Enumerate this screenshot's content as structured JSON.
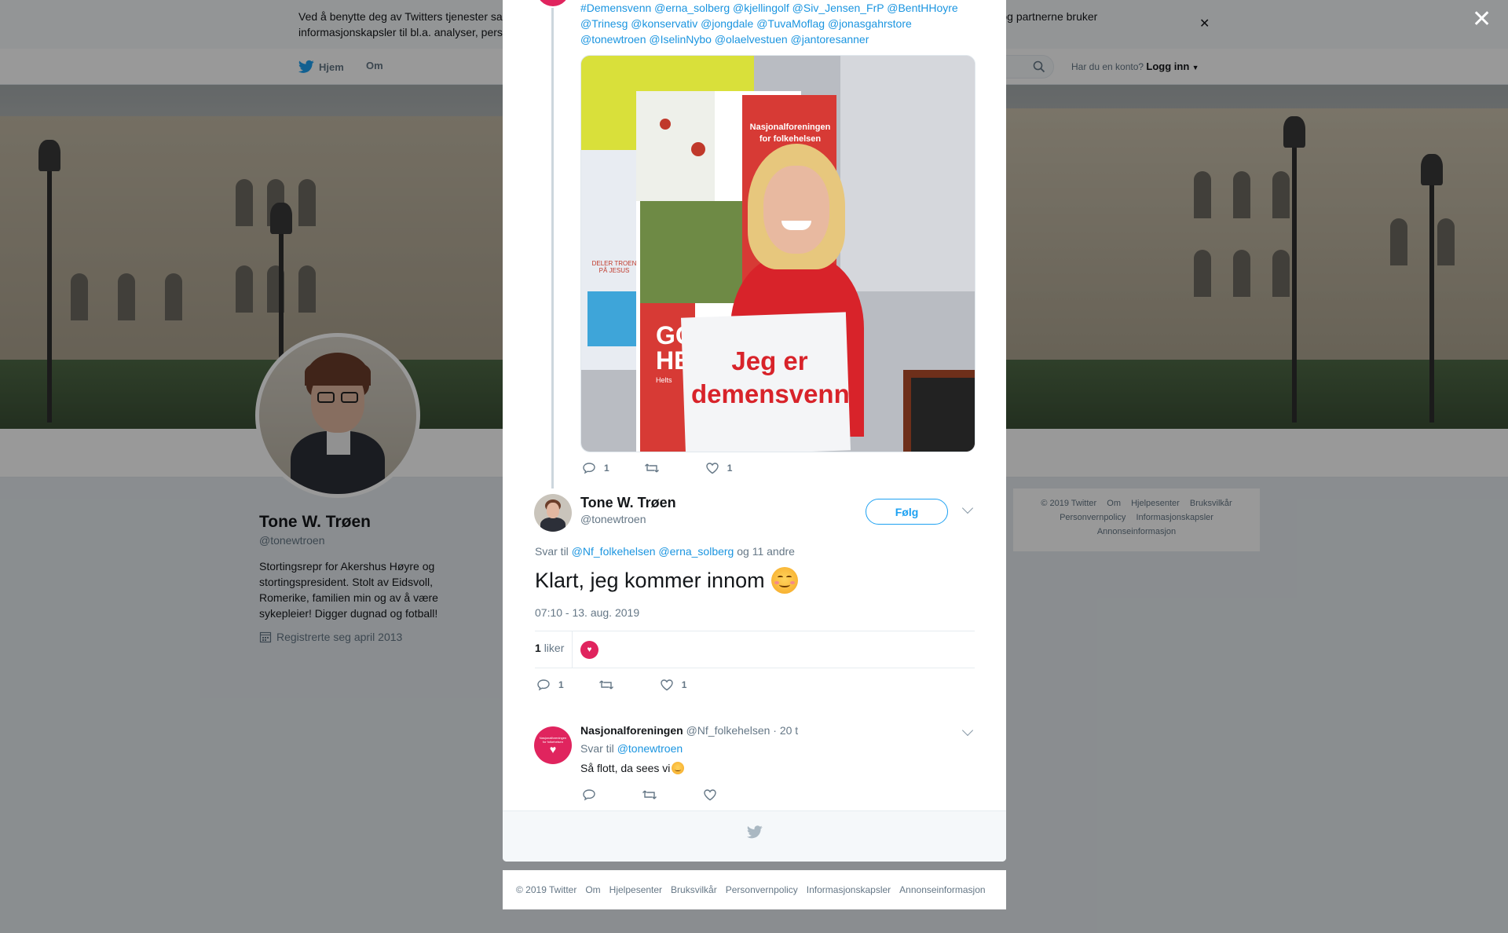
{
  "cookie_bar": {
    "text": "Ved å benytte deg av Twitters tjenester samtykker du i at vi kan bruke informasjonskapsler, inkludert informasjonskapsler fra tredjeparter. Twitter og partnerne bruker informasjonskapsler til bl.a. analyser, personalisering og annonser."
  },
  "topnav": {
    "home_label": "Hjem",
    "about_label": "Om",
    "account_prompt": "Har du en konto?",
    "login_label": "Logg inn"
  },
  "profile": {
    "name": "Tone W. Trøen",
    "handle": "@tonewtroen",
    "bio": "Stortingsrepr for Akershus Høyre og stortingspresident. Stolt av Eidsvoll, Romerike, familien min og av å være sykepleier! Digger dugnad og fotball!",
    "joined": "Registrerte seg april 2013"
  },
  "side_footer": {
    "links": [
      "© 2019 Twitter",
      "Om",
      "Hjelpesenter",
      "Bruksvilkår",
      "Personvernpolicy",
      "Informasjonskapsler",
      "Annonseinformasjon"
    ]
  },
  "prev_tweet": {
    "tag_lines": [
      "#Demensvenn @erna_solberg @kjellingolf  @Siv_Jensen_FrP @BentHHoyre",
      "@Trinesg @konservativ @jongdale @TuvaMoflag @jonasgahrstore",
      "@tonewtroen @IselinNybo @olaelvestuen @jantoresanner"
    ],
    "image": {
      "banner_org": "Nasjonalforeningen",
      "banner_sub": "for folkehelsen",
      "sign_line1": "Jeg er",
      "sign_line2": "demensvenn",
      "side_banner_text": "DELER TROEN PÅ JESUS",
      "partial_text_1": "GO",
      "partial_text_2": "HE",
      "partial_text_3": "Helts"
    },
    "reply_count": "1",
    "like_count": "1"
  },
  "main_tweet": {
    "name": "Tone W. Trøen",
    "handle": "@tonewtroen",
    "follow_label": "Følg",
    "reply_prefix": "Svar til",
    "reply_mention_1": "@Nf_folkehelsen",
    "reply_mention_2": "@erna_solberg",
    "reply_suffix": "og 11 andre",
    "text": "Klart, jeg kommer innom",
    "timestamp": "07:10 - 13. aug. 2019",
    "likes_number": "1",
    "likes_label": "liker",
    "reply_count": "1",
    "like_count": "1"
  },
  "reply_tweet": {
    "name": "Nasjonalforeningen",
    "handle": "@Nf_folkehelsen",
    "age": "· 20 t",
    "reply_prefix": "Svar til",
    "reply_mention": "@tonewtroen",
    "text": "Så flott, da sees vi",
    "avatar_text": "Nasjonalforeningen for folkehelsen"
  },
  "modal_footer": {
    "links": [
      "© 2019 Twitter",
      "Om",
      "Hjelpesenter",
      "Bruksvilkår",
      "Personvernpolicy",
      "Informasjonskapsler",
      "Annonseinformasjon"
    ]
  },
  "colors": {
    "twitter_blue": "#1da1f2",
    "link_blue": "#1b95e0",
    "brand_red": "#e0245e",
    "muted": "#657786"
  }
}
